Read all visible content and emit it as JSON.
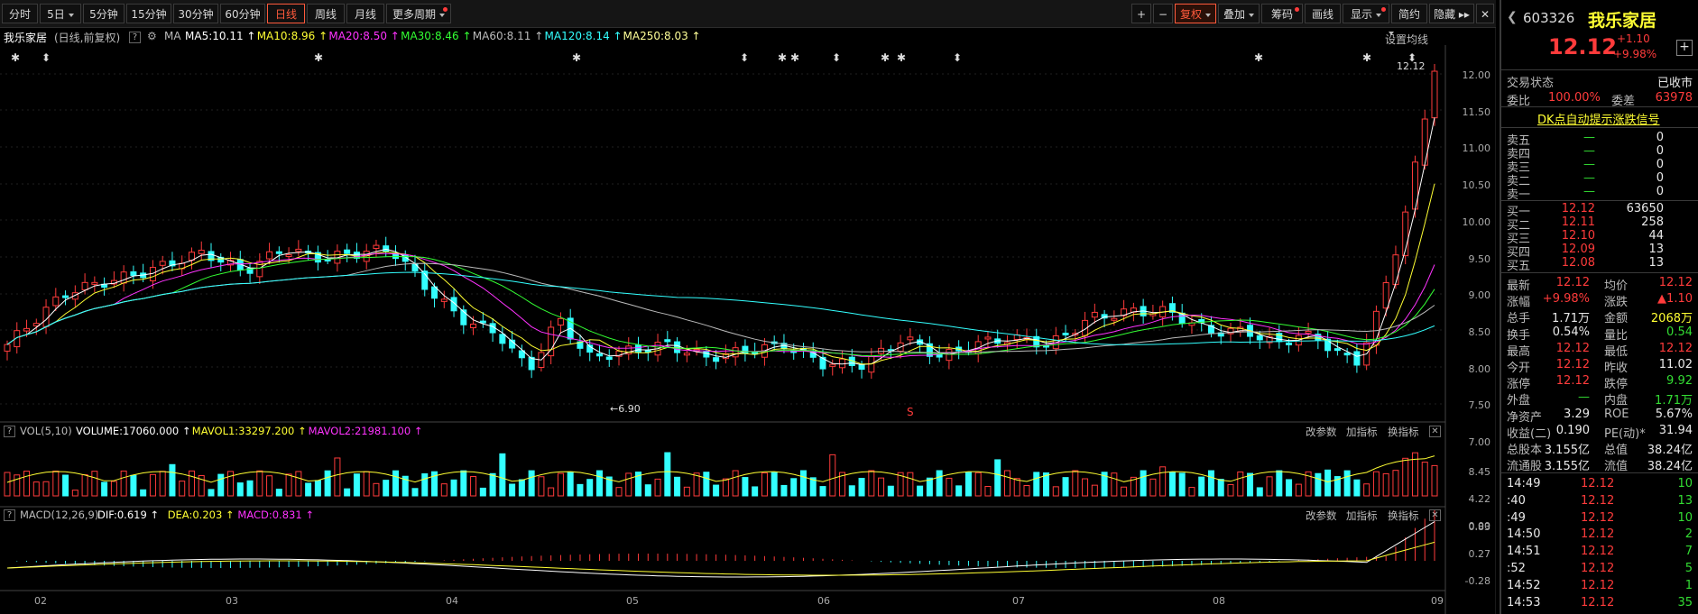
{
  "toolbar": {
    "periods": [
      "分时",
      "5日",
      "5分钟",
      "15分钟",
      "30分钟",
      "60分钟",
      "日线",
      "周线",
      "月线",
      "更多周期"
    ],
    "active_period": "日线",
    "right_buttons": [
      "+",
      "−",
      "复权",
      "叠加",
      "筹码",
      "画线",
      "显示",
      "简约",
      "隐藏 ▸▸"
    ],
    "close_icon": "✕"
  },
  "chart": {
    "title": "我乐家居",
    "subtitle": "(日线,前复权)",
    "ma_label": "MA",
    "ma_values": [
      {
        "text": "MA5:10.11",
        "color": "#ffffff"
      },
      {
        "text": "MA10:8.96",
        "color": "#ffff33"
      },
      {
        "text": "MA20:8.50",
        "color": "#ff33ff"
      },
      {
        "text": "MA30:8.46",
        "color": "#33ff33"
      },
      {
        "text": "MA60:8.11",
        "color": "#bbbbbb"
      },
      {
        "text": "MA120:8.14",
        "color": "#33ffff"
      },
      {
        "text": "MA250:8.03",
        "color": "#ffff99"
      }
    ],
    "settings_label": "设置均线",
    "price_axis": [
      "12.00",
      "11.50",
      "11.00",
      "10.50",
      "10.00",
      "9.50",
      "9.00",
      "8.50",
      "8.00",
      "7.50",
      "7.00"
    ],
    "high_marker": "12.12",
    "low_marker": "6.90",
    "s_marker": "S",
    "volume_panel": {
      "name": "VOL(5,10)",
      "values": [
        {
          "text": "VOLUME:17060.000",
          "color": "#ffffff"
        },
        {
          "text": "MAVOL1:33297.200",
          "color": "#ffff33"
        },
        {
          "text": "MAVOL2:21981.100",
          "color": "#ff33ff"
        }
      ],
      "axis": [
        "8.45",
        "4.22",
        "0.00"
      ],
      "buttons": [
        "改参数",
        "加指标",
        "换指标"
      ]
    },
    "macd_panel": {
      "name": "MACD(12,26,9)",
      "values": [
        {
          "text": "DIF:0.619",
          "color": "#ffffff"
        },
        {
          "text": "DEA:0.203",
          "color": "#ffff33"
        },
        {
          "text": "MACD:0.831",
          "color": "#ff33ff"
        }
      ],
      "axis": [
        "0.83",
        "0.27",
        "-0.28"
      ],
      "buttons": [
        "改参数",
        "加指标",
        "换指标"
      ]
    },
    "months": [
      "02",
      "03",
      "04",
      "05",
      "06",
      "07",
      "08",
      "09"
    ]
  },
  "quote": {
    "code": "603326",
    "name": "我乐家居",
    "price": "12.12",
    "change": "+1.10",
    "change_pct": "+9.98%",
    "status_label": "交易状态",
    "status": "已收市",
    "weibi_label": "委比",
    "weibi": "100.00%",
    "weicha_label": "委差",
    "weicha": "63978",
    "dk_link": "DK点自动提示涨跌信号",
    "asks": [
      {
        "label": "卖五",
        "price": "—",
        "vol": "0"
      },
      {
        "label": "卖四",
        "price": "—",
        "vol": "0"
      },
      {
        "label": "卖三",
        "price": "—",
        "vol": "0"
      },
      {
        "label": "卖二",
        "price": "—",
        "vol": "0"
      },
      {
        "label": "卖一",
        "price": "—",
        "vol": "0"
      }
    ],
    "bids": [
      {
        "label": "买一",
        "price": "12.12",
        "vol": "63650"
      },
      {
        "label": "买二",
        "price": "12.11",
        "vol": "258"
      },
      {
        "label": "买三",
        "price": "12.10",
        "vol": "44"
      },
      {
        "label": "买四",
        "price": "12.09",
        "vol": "13"
      },
      {
        "label": "买五",
        "price": "12.08",
        "vol": "13"
      }
    ],
    "stats": [
      {
        "l1": "最新",
        "v1": "12.12",
        "c1": "red",
        "l2": "均价",
        "v2": "12.12",
        "c2": "red"
      },
      {
        "l1": "涨幅",
        "v1": "+9.98%",
        "c1": "red",
        "l2": "涨跌",
        "v2": "▲1.10",
        "c2": "red"
      },
      {
        "l1": "总手",
        "v1": "1.71万",
        "c1": "white",
        "l2": "金额",
        "v2": "2068万",
        "c2": "yellow"
      },
      {
        "l1": "换手",
        "v1": "0.54%",
        "c1": "white",
        "l2": "量比",
        "v2": "0.54",
        "c2": "green"
      },
      {
        "l1": "最高",
        "v1": "12.12",
        "c1": "red",
        "l2": "最低",
        "v2": "12.12",
        "c2": "red"
      },
      {
        "l1": "今开",
        "v1": "12.12",
        "c1": "red",
        "l2": "昨收",
        "v2": "11.02",
        "c2": "white"
      },
      {
        "l1": "涨停",
        "v1": "12.12",
        "c1": "red",
        "l2": "跌停",
        "v2": "9.92",
        "c2": "green"
      },
      {
        "l1": "外盘",
        "v1": "—",
        "c1": "green",
        "l2": "内盘",
        "v2": "1.71万",
        "c2": "green"
      },
      {
        "l1": "净资产",
        "v1": "3.29",
        "c1": "white",
        "l2": "ROE",
        "v2": "5.67%",
        "c2": "white"
      },
      {
        "l1": "收益(二)",
        "v1": "0.190",
        "c1": "white",
        "l2": "PE(动)*",
        "v2": "31.94",
        "c2": "white"
      },
      {
        "l1": "总股本",
        "v1": "3.155亿",
        "c1": "white",
        "l2": "总值",
        "v2": "38.24亿",
        "c2": "white"
      },
      {
        "l1": "流通股",
        "v1": "3.155亿",
        "c1": "white",
        "l2": "流值",
        "v2": "38.24亿",
        "c2": "white"
      }
    ],
    "ticks": [
      {
        "time": "14:49",
        "price": "12.12",
        "vol": "10"
      },
      {
        "time": ":40",
        "price": "12.12",
        "vol": "13"
      },
      {
        "time": ":49",
        "price": "12.12",
        "vol": "10"
      },
      {
        "time": "14:50",
        "price": "12.12",
        "vol": "2"
      },
      {
        "time": "14:51",
        "price": "12.12",
        "vol": "7"
      },
      {
        "time": ":52",
        "price": "12.12",
        "vol": "5"
      },
      {
        "time": "14:52",
        "price": "12.12",
        "vol": "1"
      },
      {
        "time": "14:53",
        "price": "12.12",
        "vol": "35"
      }
    ],
    "add_icon": "+",
    "arrow_icon": "❮"
  }
}
